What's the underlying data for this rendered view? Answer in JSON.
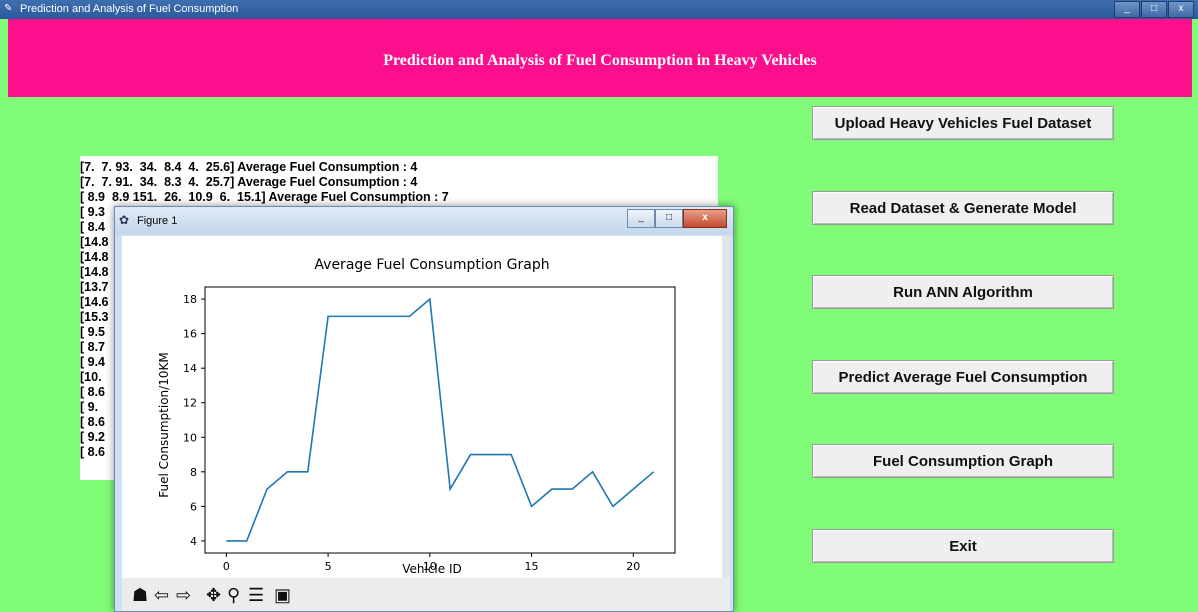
{
  "window": {
    "title": "Prediction and Analysis of Fuel Consumption",
    "controls": [
      "_",
      "□",
      "x"
    ]
  },
  "header": {
    "title": "Prediction and Analysis of Fuel Consumption in Heavy Vehicles"
  },
  "buttons": {
    "upload": "Upload Heavy Vehicles Fuel Dataset",
    "read": "Read Dataset & Generate Model",
    "run": "Run ANN Algorithm",
    "predict": "Predict Average Fuel Consumption",
    "graph": "Fuel Consumption Graph",
    "exit": "Exit"
  },
  "output_lines": [
    "[7.  7. 93.  34.  8.4  4.  25.6] Average Fuel Consumption : 4",
    "[7.  7. 91.  34.  8.3  4.  25.7] Average Fuel Consumption : 4",
    "[ 8.9  8.9 151.  26.  10.9  6.  15.1] Average Fuel Consumption : 7",
    "[ 9.3",
    "[ 8.4",
    "[14.8",
    "[14.8",
    "[14.8",
    "[13.7",
    "[14.6",
    "[15.3",
    "[ 9.5",
    "[ 8.7",
    "[ 9.4",
    "[10.",
    "[ 8.6",
    "[ 9.",
    "[ 8.6",
    "[ 9.2",
    "[ 8.6"
  ],
  "figure_window": {
    "title": "Figure 1",
    "controls": [
      "_",
      "□",
      "x"
    ]
  },
  "toolbar_icons": [
    "home-icon",
    "back-icon",
    "forward-icon",
    "pan-icon",
    "zoom-icon",
    "configure-subplots-icon",
    "save-icon"
  ],
  "colors": {
    "background": "#80fc78",
    "header": "#fb0f8c",
    "line": "#1f77b4"
  },
  "chart_data": {
    "type": "line",
    "title": "Average Fuel Consumption Graph",
    "xlabel": "Vehicle ID",
    "ylabel": "Fuel Consumption/10KM",
    "x": [
      0,
      1,
      2,
      3,
      4,
      5,
      6,
      7,
      8,
      9,
      10,
      11,
      12,
      13,
      14,
      15,
      16,
      17,
      18,
      19,
      20,
      21
    ],
    "series": [
      {
        "values": [
          4,
          4,
          7,
          8,
          8,
          17,
          17,
          17,
          17,
          17,
          18,
          7,
          9,
          9,
          9,
          6,
          7,
          7,
          8,
          6,
          7,
          8
        ]
      }
    ],
    "xticks": [
      0,
      5,
      10,
      15,
      20
    ],
    "yticks": [
      4,
      6,
      8,
      10,
      12,
      14,
      16,
      18
    ],
    "xlim": [
      -1.05,
      22.05
    ],
    "ylim": [
      3.3,
      18.7
    ],
    "grid": false
  }
}
